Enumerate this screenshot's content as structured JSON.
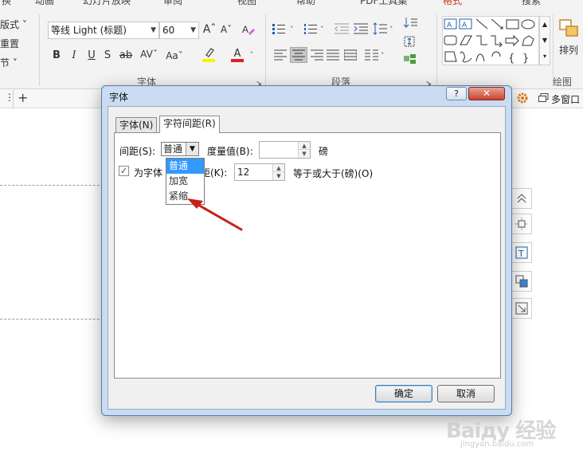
{
  "ribbon": {
    "tabs": [
      "换",
      "动画",
      "幻灯片放映",
      "审阅",
      "视图",
      "帮助",
      "PDF工具集",
      "格式",
      "搜索"
    ],
    "left_items": [
      "版式 ˅",
      "重置",
      "节 ˅"
    ],
    "font_name": "等线 Light (标题)",
    "font_size": "60",
    "group_font": "字体",
    "group_paragraph": "段落",
    "group_drawing": "绘图",
    "arrange_label": "排列",
    "bold": "B",
    "italic": "I",
    "underline": "U",
    "shadow": "S",
    "strike": "ab",
    "highlight_color": "#ffef00",
    "font_color": "#e02020",
    "multi_window": "多窗口"
  },
  "dialog": {
    "title": "字体",
    "help": "?",
    "close": "✕",
    "tab_font": "字体(N)",
    "tab_spacing": "字符间距(R)",
    "spacing_label": "间距(S):",
    "spacing_value": "普通",
    "measure_label": "度量值(B):",
    "measure_value": "",
    "measure_unit": "磅",
    "kern_label": "为字体",
    "kern_label_tail": "距(K):",
    "kern_value": "12",
    "kern_suffix": "等于或大于(磅)(O)",
    "options": [
      "普通",
      "加宽",
      "紧缩"
    ],
    "ok": "确定",
    "cancel": "取消"
  },
  "watermark": {
    "text": "Baiду 经验",
    "sub": "jingyan.baidu.com"
  }
}
